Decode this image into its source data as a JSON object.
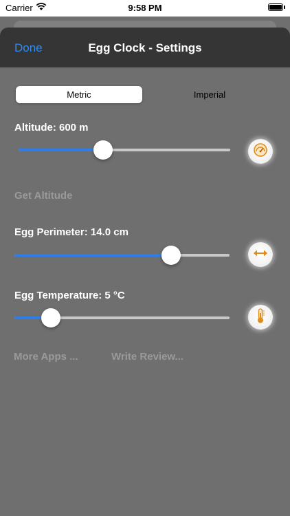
{
  "status": {
    "carrier": "Carrier",
    "time": "9:58 PM"
  },
  "nav": {
    "done": "Done",
    "title": "Egg Clock - Settings"
  },
  "units": {
    "options": [
      "Metric",
      "Imperial"
    ],
    "selected": "Metric"
  },
  "altitude": {
    "label": "Altitude: 600 m",
    "level": 0.4
  },
  "get_altitude": "Get Altitude",
  "perimeter": {
    "label": "Egg Perimeter: 14.0 cm",
    "level": 0.73
  },
  "temperature": {
    "label": "Egg Temperature: 5 °C",
    "level": 0.17
  },
  "links": {
    "more_apps": "More Apps ...",
    "write_review": "Write Review..."
  },
  "icons": {
    "altitude": "gauge-icon",
    "perimeter": "horizontal-arrows-icon",
    "temperature": "thermometer-icon"
  },
  "colors": {
    "accent": "#2f7de8",
    "icon_accent": "#e08c1a",
    "nav_bg": "#353535",
    "background": "#6f6f6f"
  }
}
